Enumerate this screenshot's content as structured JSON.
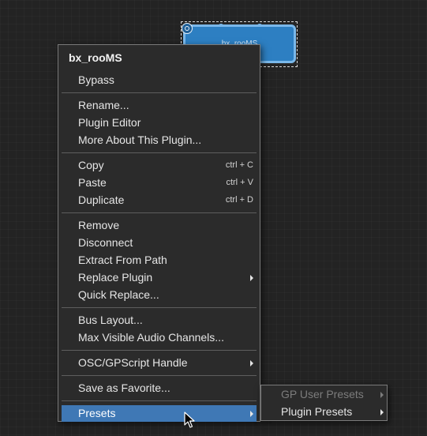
{
  "canvas": {
    "plugin_block": {
      "label": "bx_rooMS"
    }
  },
  "menu": {
    "title": "bx_rooMS",
    "groups": [
      [
        {
          "label": "Bypass"
        }
      ],
      [
        {
          "label": "Rename..."
        },
        {
          "label": "Plugin Editor"
        },
        {
          "label": "More About This Plugin..."
        }
      ],
      [
        {
          "label": "Copy",
          "shortcut": "ctrl + C"
        },
        {
          "label": "Paste",
          "shortcut": "ctrl + V"
        },
        {
          "label": "Duplicate",
          "shortcut": "ctrl + D"
        }
      ],
      [
        {
          "label": "Remove"
        },
        {
          "label": "Disconnect"
        },
        {
          "label": "Extract From Path"
        },
        {
          "label": "Replace Plugin",
          "submenu": true
        },
        {
          "label": "Quick Replace..."
        }
      ],
      [
        {
          "label": "Bus Layout..."
        },
        {
          "label": "Max Visible Audio Channels..."
        }
      ],
      [
        {
          "label": "OSC/GPScript Handle",
          "submenu": true
        }
      ],
      [
        {
          "label": "Save as Favorite..."
        }
      ],
      [
        {
          "label": "Presets",
          "submenu": true,
          "active": true
        }
      ]
    ]
  },
  "submenu": {
    "items": [
      {
        "label": "GP User Presets",
        "disabled": true
      },
      {
        "label": "Plugin Presets",
        "disabled": false
      }
    ]
  },
  "colors": {
    "highlight": "#3f78b5",
    "plugin_block": "#2d7fc2",
    "menu_bg": "#2b2b2b"
  }
}
